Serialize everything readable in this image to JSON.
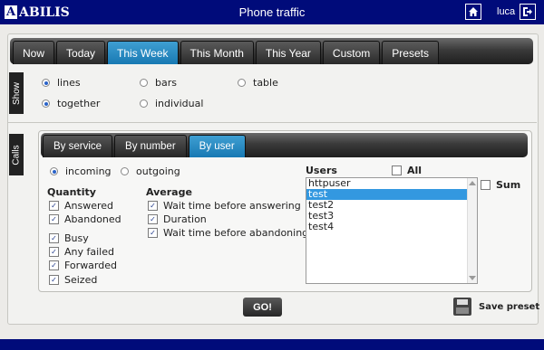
{
  "header": {
    "logo_text": "ABILIS",
    "logo_letter": "A",
    "title": "Phone traffic",
    "user": "luca"
  },
  "period_tabs": [
    {
      "label": "Now",
      "active": false
    },
    {
      "label": "Today",
      "active": false
    },
    {
      "label": "This Week",
      "active": true
    },
    {
      "label": "This Month",
      "active": false
    },
    {
      "label": "This Year",
      "active": false
    },
    {
      "label": "Custom",
      "active": false
    },
    {
      "label": "Presets",
      "active": false
    }
  ],
  "show": {
    "section_label": "Show",
    "style_options": [
      {
        "label": "lines",
        "selected": true
      },
      {
        "label": "bars",
        "selected": false
      },
      {
        "label": "table",
        "selected": false
      }
    ],
    "grouping_options": [
      {
        "label": "together",
        "selected": true
      },
      {
        "label": "individual",
        "selected": false
      }
    ]
  },
  "calls": {
    "section_label": "Calls",
    "subtabs": [
      {
        "label": "By service",
        "active": false
      },
      {
        "label": "By number",
        "active": false
      },
      {
        "label": "By user",
        "active": true
      }
    ],
    "direction": [
      {
        "label": "incoming",
        "selected": true
      },
      {
        "label": "outgoing",
        "selected": false
      }
    ],
    "quantity_heading": "Quantity",
    "quantity_items": [
      {
        "label": "Answered",
        "checked": true
      },
      {
        "label": "Abandoned",
        "checked": true
      },
      {
        "label": "Busy",
        "checked": true
      },
      {
        "label": "Any failed",
        "checked": true
      },
      {
        "label": "Forwarded",
        "checked": true
      },
      {
        "label": "Seized",
        "checked": true
      }
    ],
    "average_heading": "Average",
    "average_items": [
      {
        "label": "Wait time before answering",
        "checked": true
      },
      {
        "label": "Duration",
        "checked": true
      },
      {
        "label": "Wait time before abandoning",
        "checked": true
      }
    ],
    "users_heading": "Users",
    "all_label": "All",
    "all_checked": false,
    "sum_label": "Sum",
    "sum_checked": false,
    "users": [
      {
        "name": "httpuser",
        "selected": false
      },
      {
        "name": "test",
        "selected": true
      },
      {
        "name": "test2",
        "selected": false
      },
      {
        "name": "test3",
        "selected": false
      },
      {
        "name": "test4",
        "selected": false
      }
    ]
  },
  "actions": {
    "go_label": "GO!",
    "save_preset_label": "Save preset"
  },
  "colors": {
    "header_bg": "#000b7a",
    "active_tab": "#1879b3",
    "selected_row": "#3398e0"
  }
}
